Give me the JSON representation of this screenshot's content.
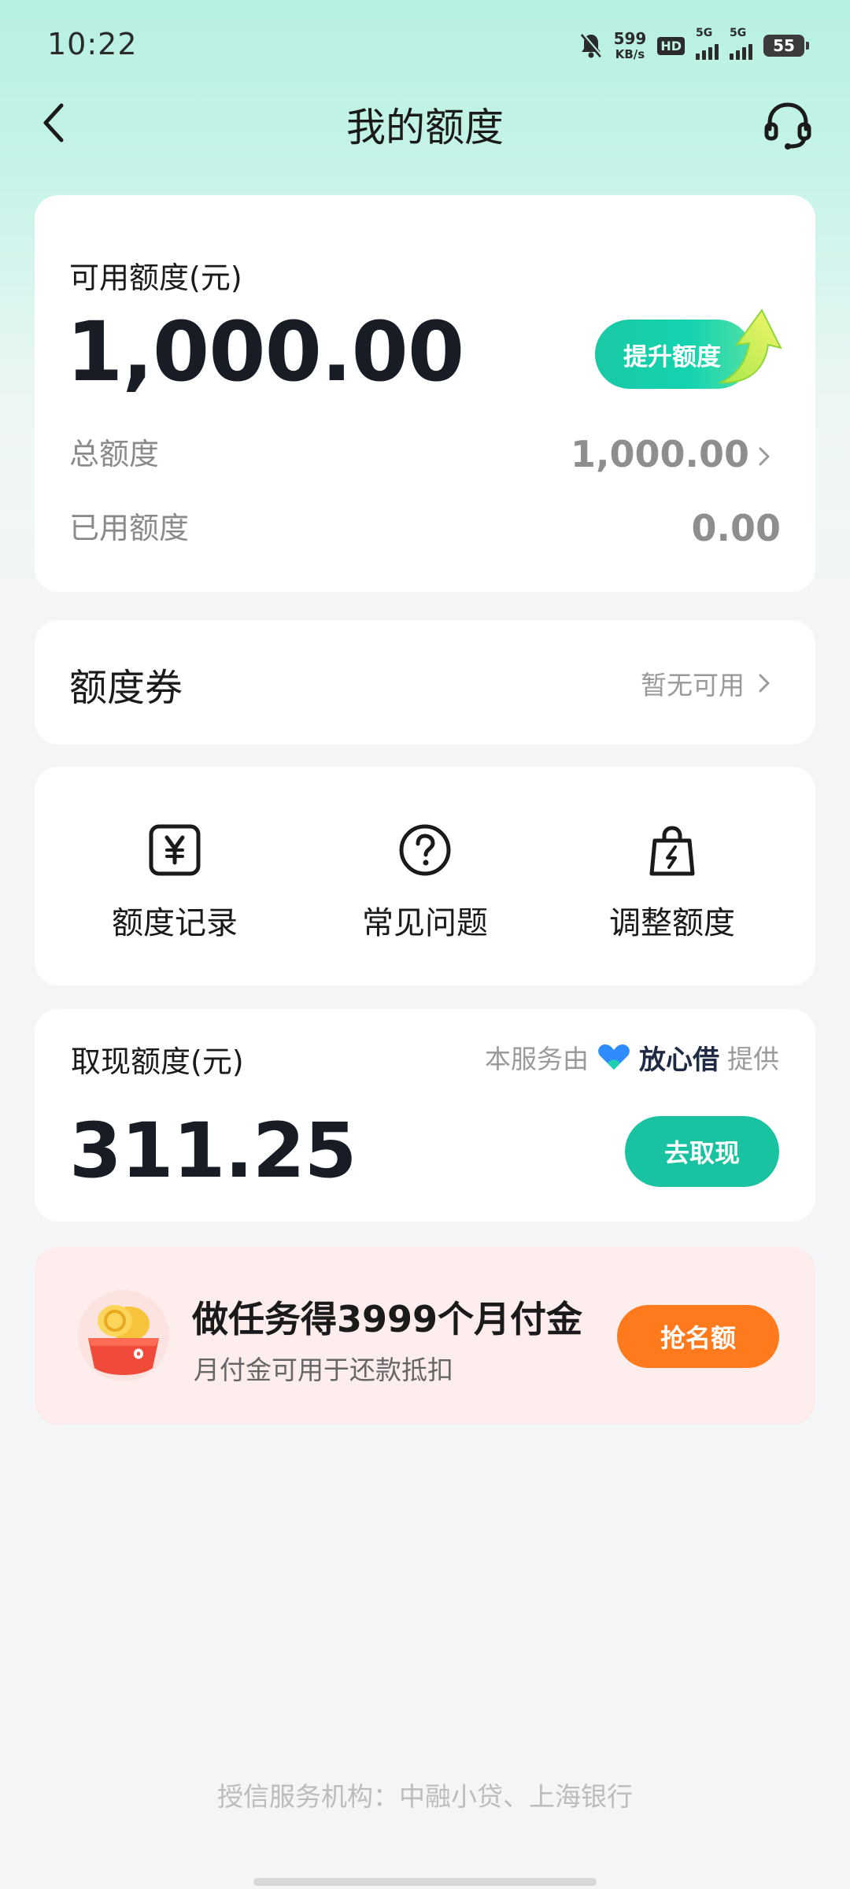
{
  "status_bar": {
    "time": "10:22",
    "net_speed": "599",
    "net_speed_unit": "KB/s",
    "hd_label": "HD",
    "signal1_label": "5G",
    "signal2_label": "5G",
    "battery": "55"
  },
  "nav": {
    "title": "我的额度"
  },
  "quota": {
    "available_label": "可用额度(元)",
    "available_amount": "1,000.00",
    "raise_button": "提升额度",
    "total_label": "总额度",
    "total_value": "1,000.00",
    "used_label": "已用额度",
    "used_value": "0.00"
  },
  "coupon": {
    "title": "额度券",
    "status": "暂无可用"
  },
  "shortcuts": [
    {
      "label": "额度记录",
      "icon": "yen-receipt-icon"
    },
    {
      "label": "常见问题",
      "icon": "question-circle-icon"
    },
    {
      "label": "调整额度",
      "icon": "shopping-bag-bolt-icon"
    }
  ],
  "cash": {
    "label": "取现额度(元)",
    "provider_prefix": "本服务由",
    "provider_brand": "放心借",
    "provider_suffix": "提供",
    "amount": "311.25",
    "button": "去取现"
  },
  "promo": {
    "title": "做任务得3999个月付金",
    "subtitle": "月付金可用于还款抵扣",
    "button": "抢名额"
  },
  "footer": {
    "note": "授信服务机构：中融小贷、上海银行"
  },
  "colors": {
    "accent": "#19c3a2",
    "promo_button": "#ff7a1c",
    "promo_background": "#fdeeed"
  }
}
